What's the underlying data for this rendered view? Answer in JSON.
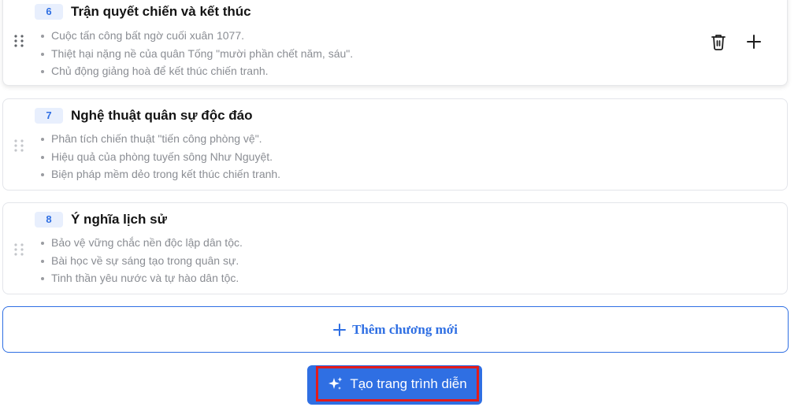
{
  "chapters": [
    {
      "number": "6",
      "title": "Trận quyết chiến và kết thúc",
      "bullets": [
        "Cuộc tấn công bất ngờ cuối xuân 1077.",
        "Thiệt hại nặng nề của quân Tống \"mười phần chết năm, sáu\".",
        "Chủ động giảng hoà để kết thúc chiến tranh."
      ],
      "active": true
    },
    {
      "number": "7",
      "title": "Nghệ thuật quân sự độc đáo",
      "bullets": [
        "Phân tích chiến thuật \"tiến công phòng vệ\".",
        "Hiệu quả của phòng tuyến sông Như Nguyệt.",
        "Biện pháp mềm dẻo trong kết thúc chiến tranh."
      ],
      "active": false
    },
    {
      "number": "8",
      "title": "Ý nghĩa lịch sử",
      "bullets": [
        "Bảo vệ vững chắc nền độc lập dân tộc.",
        "Bài học về sự sáng tạo trong quân sự.",
        "Tinh thần yêu nước và tự hào dân tộc."
      ],
      "active": false
    }
  ],
  "actions": {
    "delete_icon": "trash-icon",
    "add_icon": "plus-icon"
  },
  "add_chapter": {
    "label": "Thêm chương mới",
    "icon": "plus-icon"
  },
  "create_button": {
    "label": "Tạo trang trình diễn",
    "icon": "sparkle-icon"
  },
  "colors": {
    "accent": "#2f6fe3",
    "highlight_border": "#e21b1b",
    "badge_bg": "#e8effd",
    "muted_text": "#8a8d93"
  }
}
